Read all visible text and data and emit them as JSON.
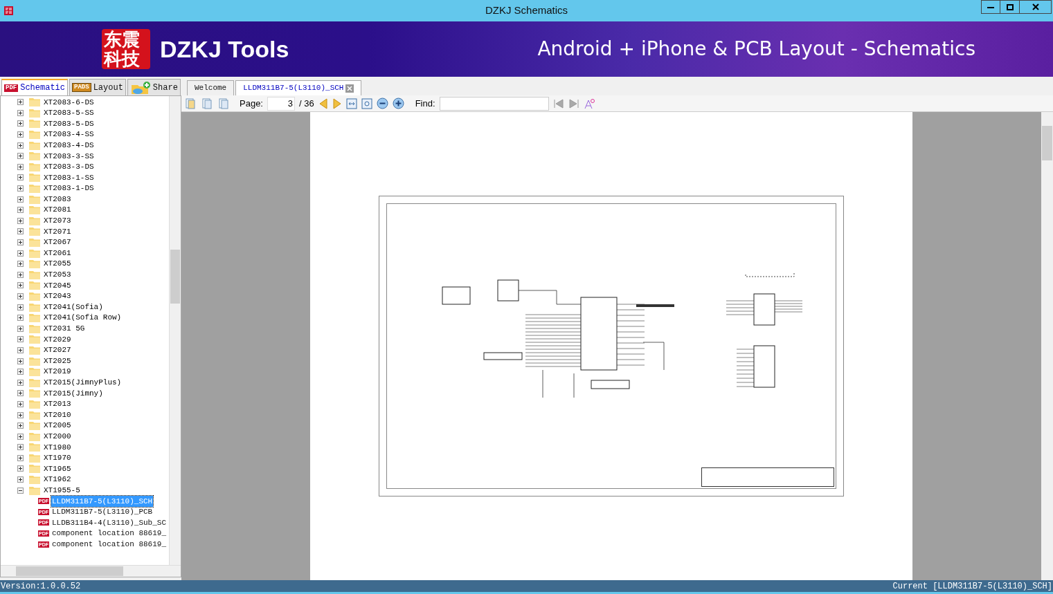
{
  "window": {
    "title": "DZKJ Schematics"
  },
  "banner": {
    "logo": "东震科技",
    "name": "DZKJ Tools",
    "tagline": "Android + iPhone & PCB Layout - Schematics"
  },
  "side_tabs": [
    {
      "label": "Schematic",
      "badge": "PDF",
      "selected": true
    },
    {
      "label": "Layout",
      "badge": "PADS",
      "selected": false
    },
    {
      "label": "Share",
      "selected": false
    }
  ],
  "doc_tabs": [
    {
      "label": "Welcome",
      "selected": false,
      "closable": false
    },
    {
      "label": "LLDM311B7-5(L3110)_SCH",
      "selected": true,
      "closable": true
    }
  ],
  "tree": [
    {
      "label": "XT2083-6-DS",
      "expanded": false
    },
    {
      "label": "XT2083-5-SS",
      "expanded": false
    },
    {
      "label": "XT2083-5-DS",
      "expanded": false
    },
    {
      "label": "XT2083-4-SS",
      "expanded": false
    },
    {
      "label": "XT2083-4-DS",
      "expanded": false
    },
    {
      "label": "XT2083-3-SS",
      "expanded": false
    },
    {
      "label": "XT2083-3-DS",
      "expanded": false
    },
    {
      "label": "XT2083-1-SS",
      "expanded": false
    },
    {
      "label": "XT2083-1-DS",
      "expanded": false
    },
    {
      "label": "XT2083",
      "expanded": false
    },
    {
      "label": "XT2081",
      "expanded": false
    },
    {
      "label": "XT2073",
      "expanded": false
    },
    {
      "label": "XT2071",
      "expanded": false
    },
    {
      "label": "XT2067",
      "expanded": false
    },
    {
      "label": "XT2061",
      "expanded": false
    },
    {
      "label": "XT2055",
      "expanded": false
    },
    {
      "label": "XT2053",
      "expanded": false
    },
    {
      "label": "XT2045",
      "expanded": false
    },
    {
      "label": "XT2043",
      "expanded": false
    },
    {
      "label": "XT2041(Sofia)",
      "expanded": false
    },
    {
      "label": "XT2041(Sofia Row)",
      "expanded": false
    },
    {
      "label": "XT2031 5G",
      "expanded": false
    },
    {
      "label": "XT2029",
      "expanded": false
    },
    {
      "label": "XT2027",
      "expanded": false
    },
    {
      "label": "XT2025",
      "expanded": false
    },
    {
      "label": "XT2019",
      "expanded": false
    },
    {
      "label": "XT2015(JimnyPlus)",
      "expanded": false
    },
    {
      "label": "XT2015(Jimny)",
      "expanded": false
    },
    {
      "label": "XT2013",
      "expanded": false
    },
    {
      "label": "XT2010",
      "expanded": false
    },
    {
      "label": "XT2005",
      "expanded": false
    },
    {
      "label": "XT2000",
      "expanded": false
    },
    {
      "label": "XT1980",
      "expanded": false
    },
    {
      "label": "XT1970",
      "expanded": false
    },
    {
      "label": "XT1965",
      "expanded": false
    },
    {
      "label": "XT1962",
      "expanded": false
    },
    {
      "label": "XT1955-5",
      "expanded": true,
      "children": [
        {
          "label": "LLDM311B7-5(L3110)_SCH",
          "badge": "PDF",
          "selected": true
        },
        {
          "label": "LLDM311B7-5(L3110)_PCB",
          "badge": "PDF",
          "selected": false
        },
        {
          "label": "LLDB311B4-4(L3110)_Sub_SC",
          "badge": "PDF",
          "selected": false
        },
        {
          "label": "component location 88619_",
          "badge": "PDF",
          "selected": false
        },
        {
          "label": "component location 88619_",
          "badge": "PDF",
          "selected": false
        }
      ]
    }
  ],
  "toolbar": {
    "page_label": "Page:",
    "page": "3",
    "total": "/ 36",
    "find_label": "Find:"
  },
  "status_bar": {
    "version": "Version:1.0.0.52",
    "current": "Current [LLDM311B7-5(L3110)_SCH]"
  }
}
